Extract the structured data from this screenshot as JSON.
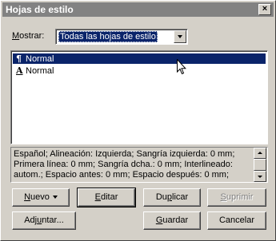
{
  "window": {
    "title": "Hojas de estilo",
    "close_label": "×"
  },
  "mostrar": {
    "label_mnemonic": "M",
    "label_rest": "ostrar:",
    "selected": "Todas las hojas de estilo"
  },
  "styles_list": {
    "items": [
      {
        "icon": "paragraph-style-icon",
        "glyph": "¶",
        "label": "Normal",
        "selected": true
      },
      {
        "icon": "character-style-icon",
        "glyph": "A",
        "label": "Normal",
        "selected": false
      }
    ]
  },
  "description": {
    "line1": "Español;  Alineación: Izquierda;  Sangría izquierda: 0 mm;",
    "line2": "Primera línea: 0 mm;  Sangría dcha.: 0 mm;  Interlineado:",
    "line3": "autom.;  Espacio antes: 0 mm;  Espacio después: 0 mm;"
  },
  "buttons": {
    "nuevo": {
      "mnemonic": "N",
      "rest": "uevo"
    },
    "editar": {
      "mnemonic": "E",
      "rest": "ditar"
    },
    "duplicar": {
      "prefix": "Du",
      "mnemonic": "p",
      "rest": "licar"
    },
    "suprimir": {
      "mnemonic": "S",
      "rest": "uprimir"
    },
    "adjuntar": {
      "prefix": "Adj",
      "mnemonic": "u",
      "rest": "ntar..."
    },
    "guardar": {
      "mnemonic": "G",
      "rest": "uardar"
    },
    "cancelar": {
      "label": "Cancelar"
    }
  },
  "colors": {
    "selection": "#0a246a",
    "face": "#d4d0c8",
    "title_inactive": "#828282"
  }
}
